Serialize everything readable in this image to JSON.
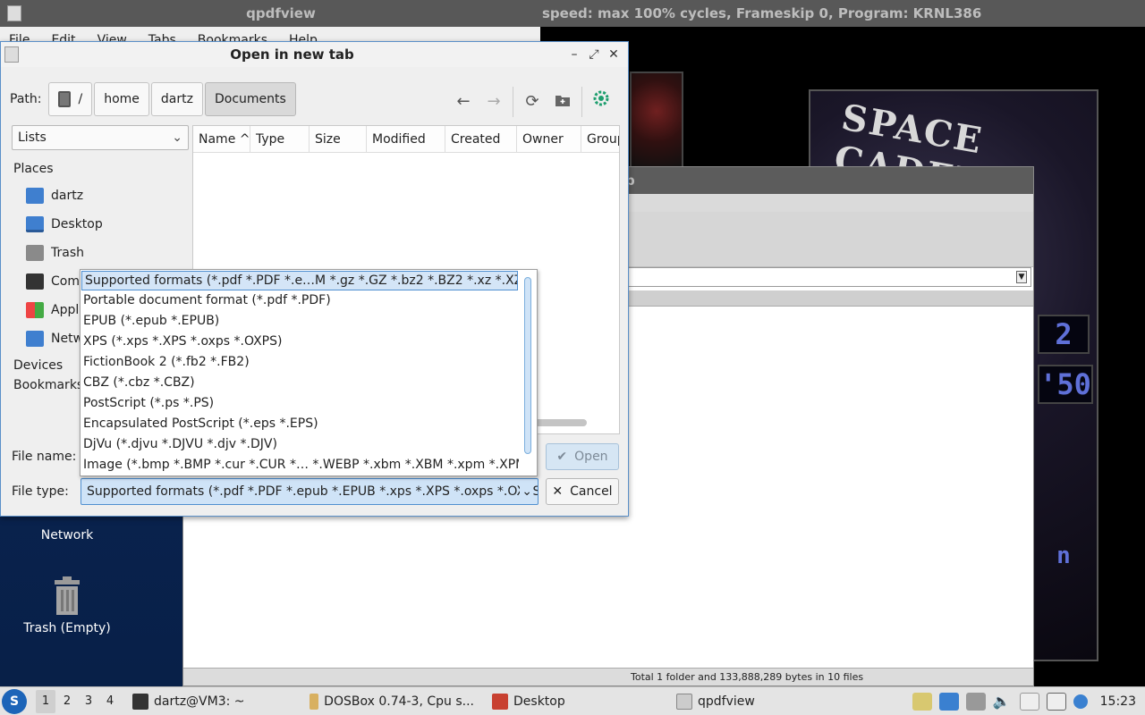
{
  "desktop": {
    "icons": [
      {
        "label": "Network"
      },
      {
        "label": "Trash (Empty)"
      }
    ]
  },
  "qpdfview": {
    "title": "qpdfview",
    "menu": [
      "File",
      "Edit",
      "View",
      "Tabs",
      "Bookmarks",
      "Help"
    ]
  },
  "dosbox": {
    "title": "speed: max 100% cycles, Frameskip  0, Program:  KRNL386",
    "logo_text": "SPACE CADET",
    "score_a": "2",
    "score_b": "'50",
    "score_c": "n"
  },
  "file_manager": {
    "title": "p",
    "status": "Total 1 folder and 133,888,289 bytes in 10 files"
  },
  "dialog": {
    "title": "Open in new tab",
    "path_label": "Path:",
    "crumbs": [
      "/",
      "home",
      "dartz",
      "Documents"
    ],
    "view_mode": "Lists",
    "places_heading": "Places",
    "places": [
      "dartz",
      "Desktop",
      "Trash",
      "Computer",
      "Applications",
      "Network"
    ],
    "devices_heading": "Devices",
    "bookmarks_heading": "Bookmarks",
    "columns": [
      "Name",
      "Type",
      "Size",
      "Modified",
      "Created",
      "Owner",
      "Group"
    ],
    "file_name_label": "File name:",
    "file_type_label": "File type:",
    "file_type_value": "Supported formats (*.pdf *.PDF *.epub *.EPUB *.xps *.XPS *.oxps *.OXPS",
    "open_label": "Open",
    "cancel_label": "Cancel",
    "file_type_options": [
      "Supported formats (*.pdf *.PDF *.e…M *.gz *.GZ *.bz2 *.BZ2 *.xz *.XZ)",
      "Portable document format (*.pdf *.PDF)",
      "EPUB (*.epub *.EPUB)",
      "XPS (*.xps *.XPS *.oxps *.OXPS)",
      "FictionBook 2 (*.fb2 *.FB2)",
      "CBZ (*.cbz *.CBZ)",
      "PostScript (*.ps *.PS)",
      "Encapsulated PostScript (*.eps *.EPS)",
      "DjVu (*.djvu *.DJVU *.djv *.DJV)",
      "Image (*.bmp *.BMP *.cur *.CUR *… *.WEBP *.xbm *.XBM *.xpm *.XPM)"
    ]
  },
  "taskbar": {
    "workspaces": [
      "1",
      "2",
      "3",
      "4"
    ],
    "tasks": [
      {
        "label": "dartz@VM3: ~"
      },
      {
        "label": "DOSBox 0.74-3, Cpu s..."
      },
      {
        "label": "Desktop"
      },
      {
        "label": "qpdfview"
      }
    ],
    "clock": "15:23"
  }
}
